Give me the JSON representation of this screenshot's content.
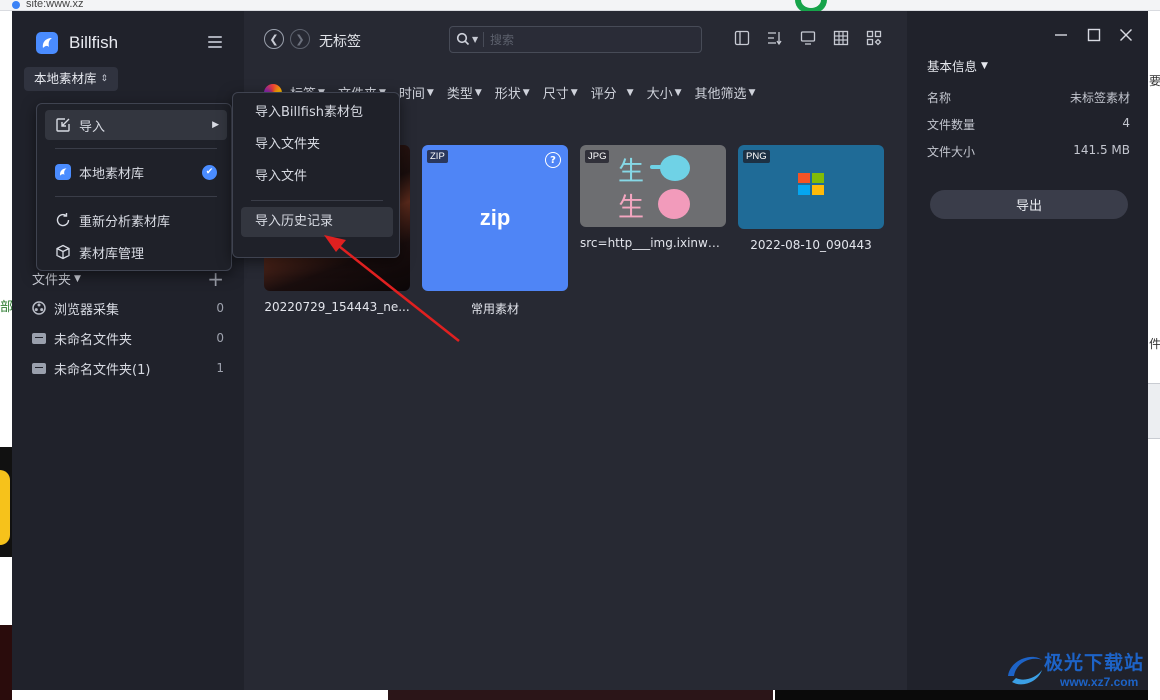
{
  "background": {
    "browser_url": "site:www.xz",
    "left_char": "部",
    "right_char1": "要",
    "right_char2": "件"
  },
  "app": {
    "name": "Billfish",
    "library_selector": "本地素材库",
    "breadcrumb": "无标签",
    "search_placeholder": "搜索"
  },
  "filters": [
    "标签",
    "文件夹",
    "时间",
    "类型",
    "形状",
    "尺寸",
    "评分",
    "大小",
    "其他筛选"
  ],
  "sidebar": {
    "folder_header": "文件夹",
    "folders": [
      {
        "label": "浏览器采集",
        "count": "0",
        "icon": "globe-icon"
      },
      {
        "label": "未命名文件夹",
        "count": "0",
        "icon": "folder-icon"
      },
      {
        "label": "未命名文件夹(1)",
        "count": "1",
        "icon": "folder-icon"
      }
    ]
  },
  "library_menu": {
    "items": [
      {
        "label": "导入",
        "icon": "import-icon"
      },
      {
        "label": "本地素材库",
        "icon": "billfish-logo-icon"
      },
      {
        "label": "重新分析素材库",
        "icon": "refresh-icon"
      },
      {
        "label": "素材库管理",
        "icon": "cube-icon"
      }
    ]
  },
  "import_submenu": {
    "items": [
      "导入Billfish素材包",
      "导入文件夹",
      "导入文件",
      "导入历史记录"
    ]
  },
  "thumbnails": [
    {
      "caption": "20220729_154443_ne...",
      "badge": ""
    },
    {
      "caption": "常用素材",
      "badge": "ZIP",
      "image_text": "zip"
    },
    {
      "caption": "src=http___img.ixinwei...",
      "badge": "JPG",
      "image_text_1": "生",
      "image_text_2": "生"
    },
    {
      "caption": "2022-08-10_090443",
      "badge": "PNG"
    }
  ],
  "details": {
    "title": "基本信息",
    "rows": [
      {
        "label": "名称",
        "value": "未标签素材"
      },
      {
        "label": "文件数量",
        "value": "4"
      },
      {
        "label": "文件大小",
        "value": "141.5 MB"
      }
    ],
    "export_label": "导出"
  },
  "watermark": {
    "text": "极光下载站",
    "url": "www.xz7.com"
  },
  "colors": {
    "accent": "#4a8cff",
    "sidebar_bg": "#20222b",
    "main_bg": "#272933",
    "annotation_arrow": "#e02020"
  }
}
